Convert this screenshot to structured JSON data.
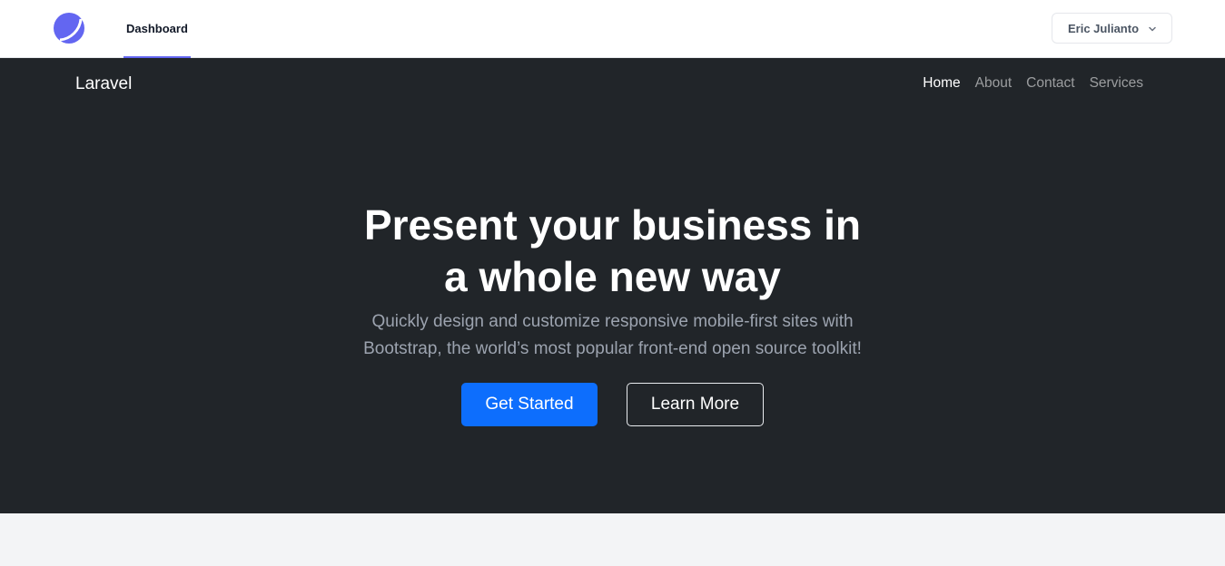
{
  "topnav": {
    "logo_icon": "laravel-jetstream-logo-icon",
    "dashboard_label": "Dashboard",
    "user_name": "Eric Julianto",
    "chevron_icon": "chevron-down-icon",
    "accent_color": "#6366f1"
  },
  "site": {
    "brand": "Laravel",
    "nav": [
      {
        "label": "Home",
        "active": true
      },
      {
        "label": "About",
        "active": false
      },
      {
        "label": "Contact",
        "active": false
      },
      {
        "label": "Services",
        "active": false
      }
    ]
  },
  "hero": {
    "headline_line1": "Present your business in",
    "headline_line2": "a whole new way",
    "sub_line1": "Quickly design and customize responsive mobile-first sites with",
    "sub_line2": "Bootstrap, the world’s most popular front-end open source toolkit!",
    "primary_button": "Get Started",
    "secondary_button": "Learn More",
    "primary_color": "#0d6efd",
    "background_color": "#212529"
  }
}
